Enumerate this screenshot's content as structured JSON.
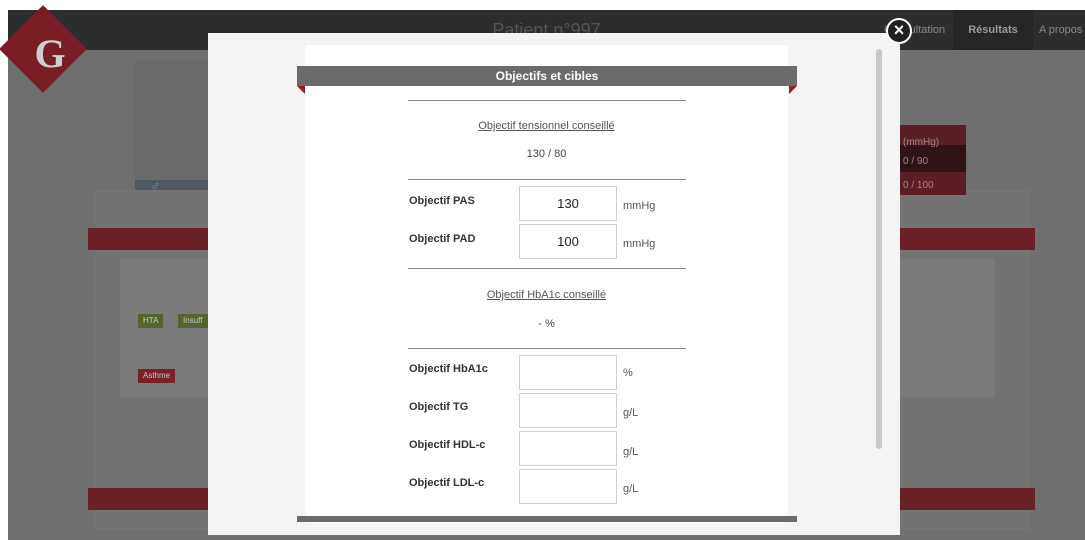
{
  "background": {
    "title": "Patient n°997",
    "nav_items": [
      "Consultation",
      "Résultats",
      "A propos"
    ],
    "logo_letter": "G",
    "tags_row1": [
      "HTA",
      "Insuff"
    ],
    "tags_row2": [
      "Asthme"
    ],
    "bp_header": "(mmHg)",
    "bp_values": [
      "0 / 90",
      "0  /  100"
    ]
  },
  "modal": {
    "header": "Objectifs et cibles",
    "close_label": "×",
    "bp_recommend_label": "Objectif tensionnel conseillé",
    "bp_recommend_value": "130 / 80",
    "fields": [
      {
        "label": "Objectif PAS",
        "value": "130",
        "unit": "mmHg"
      },
      {
        "label": "Objectif PAD",
        "value": "100",
        "unit": "mmHg"
      },
      {
        "label": "Objectif HbA1c",
        "value": "",
        "unit": "%"
      },
      {
        "label": "Objectif TG",
        "value": "",
        "unit": "g/L"
      },
      {
        "label": "Objectif HDL-c",
        "value": "",
        "unit": "g/L"
      },
      {
        "label": "Objectif LDL-c",
        "value": "",
        "unit": "g/L"
      }
    ],
    "hba1c_recommend_label": "Objectif HbA1c conseillé",
    "hba1c_recommend_value": "- %"
  }
}
